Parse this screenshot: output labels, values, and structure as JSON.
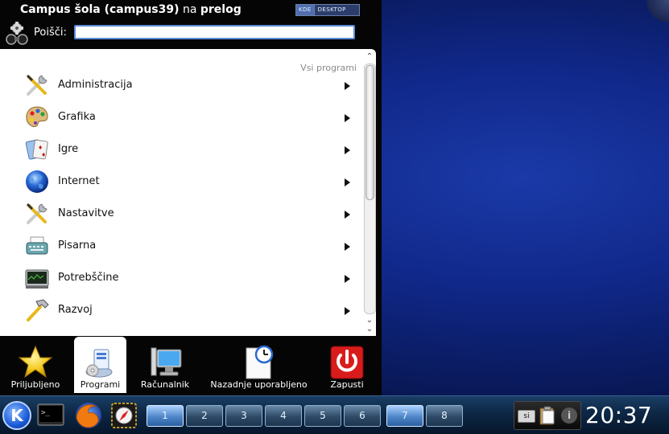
{
  "menu": {
    "user_name": "Campus šola (campus39)",
    "title_sep": "na",
    "host": "prelog",
    "logo_k": "KDE",
    "logo_desktop": "DESKTOP",
    "search_label": "Poišči:",
    "search_value": "",
    "list_header": "Vsi programi",
    "items": [
      {
        "label": "Administracija",
        "icon": "tools-icon"
      },
      {
        "label": "Grafika",
        "icon": "palette-icon"
      },
      {
        "label": "Igre",
        "icon": "cards-icon"
      },
      {
        "label": "Internet",
        "icon": "globe-icon"
      },
      {
        "label": "Nastavitve",
        "icon": "tools-icon"
      },
      {
        "label": "Pisarna",
        "icon": "typewriter-icon"
      },
      {
        "label": "Potrebščine",
        "icon": "monitor-icon"
      },
      {
        "label": "Razvoj",
        "icon": "hammer-icon"
      }
    ],
    "tabs": [
      {
        "label": "Priljubljeno",
        "icon": "star-icon"
      },
      {
        "label": "Programi",
        "icon": "applications-icon"
      },
      {
        "label": "Računalnik",
        "icon": "computer-icon"
      },
      {
        "label": "Nazadnje uporabljeno",
        "icon": "recent-icon"
      },
      {
        "label": "Zapusti",
        "icon": "power-icon"
      }
    ]
  },
  "taskbar": {
    "desktops": [
      "1",
      "2",
      "3",
      "4",
      "5",
      "6",
      "7",
      "8"
    ],
    "lang": "si",
    "clock": "20:37"
  }
}
